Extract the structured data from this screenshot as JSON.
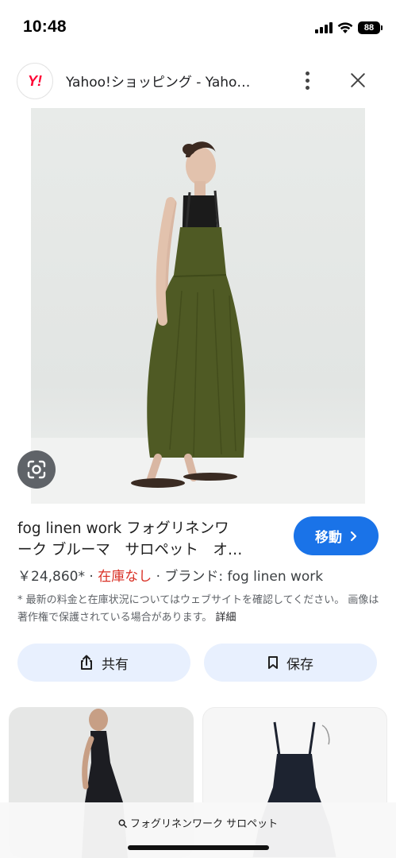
{
  "status_bar": {
    "time": "10:48",
    "battery": "88"
  },
  "header": {
    "favicon_text": "Y!",
    "site_title": "Yahoo!ショッピング - Yaho…",
    "more_icon": "more-vert-icon",
    "close_icon": "close-icon"
  },
  "product": {
    "title_line1": "fog linen work フォグリネンワ",
    "title_line2": "ーク ブルーマ　サロペット　オ…",
    "go_button": "移動",
    "price": "￥24,860*",
    "separator": "·",
    "stock": "在庫なし",
    "brand": "ブランド: fog linen work",
    "note": "* 最新の料金と在庫状況についてはウェブサイトを確認してください。 画像は著作権で保護されている場合があります。",
    "detail_link": "詳細"
  },
  "actions": {
    "share_label": "共有",
    "save_label": "保存"
  },
  "bottom": {
    "query": "フォグリネンワーク サロペット"
  },
  "colors": {
    "accent": "#1a73e8",
    "stock_red": "#d93025",
    "pill_bg": "#e8f0fe",
    "dress": "#4f5a24"
  }
}
